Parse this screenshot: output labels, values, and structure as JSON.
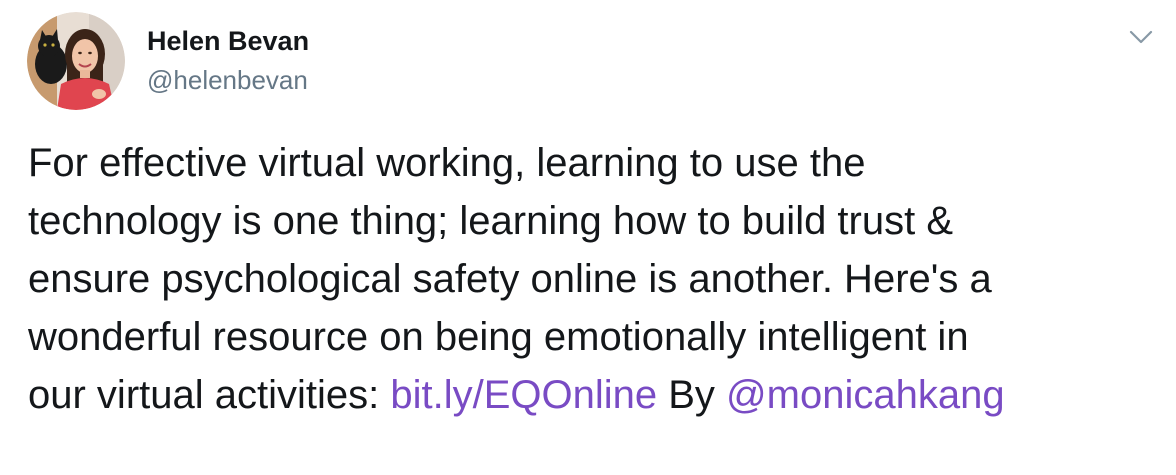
{
  "tweet": {
    "author": {
      "display_name": "Helen Bevan",
      "handle": "@helenbevan",
      "avatar_icon": "profile-photo"
    },
    "menu_icon": "chevron-down-icon",
    "body": {
      "line1": "For effective virtual working, learning to use the",
      "line2": "technology is one thing; learning how to build trust &",
      "line3": "ensure psychological safety online is another. Here's a",
      "line4": "wonderful resource on being emotionally intelligent in",
      "line5_prefix": "our virtual activities: ",
      "link_url_text": "bit.ly/EQOnline",
      "line5_middle": " By ",
      "mention_text": "@monicahkang"
    }
  },
  "colors": {
    "text": "#14171a",
    "secondary_text": "#657786",
    "link": "#794bc4",
    "background": "#ffffff"
  }
}
